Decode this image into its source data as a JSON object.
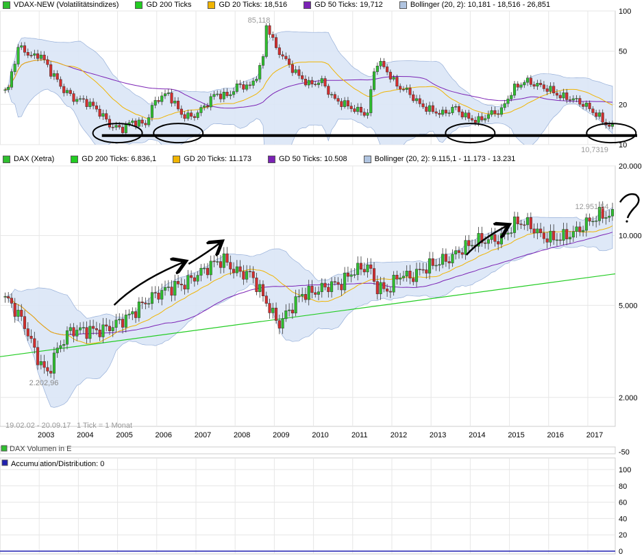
{
  "colors": {
    "candle_up": "#2fbf2f",
    "candle_down": "#d42e2e",
    "gd200": "#22cc22",
    "gd20": "#f0b400",
    "gd50": "#7b22b5",
    "bollinger_fill": "#dbe6f7",
    "bollinger_line": "#8aa6d4",
    "grid": "#e6e6e6",
    "annotation": "#000000",
    "acc_line": "#1f1fb0"
  },
  "panels": {
    "vdax": {
      "legend": [
        {
          "label": "VDAX-NEW (Volatilitätsindizes)",
          "color": "#2fbf2f"
        },
        {
          "label": "GD 200 Ticks",
          "color": "#22cc22"
        },
        {
          "label": "GD 20 Ticks: 18,516",
          "color": "#f0b400"
        },
        {
          "label": "GD 50 Ticks: 19,712",
          "color": "#7b22b5"
        },
        {
          "label": "Bollinger (20, 2): 10,181 - 18,516 - 26,851",
          "color": "#b0c4e0"
        }
      ],
      "high_label": "85,118",
      "low_label": "10,7319"
    },
    "dax": {
      "legend": [
        {
          "label": "DAX (Xetra)",
          "color": "#2fbf2f"
        },
        {
          "label": "GD 200 Ticks: 6.836,1",
          "color": "#22cc22"
        },
        {
          "label": "GD 20 Ticks: 11.173",
          "color": "#f0b400"
        },
        {
          "label": "GD 50 Ticks: 10.508",
          "color": "#7b22b5"
        },
        {
          "label": "Bollinger (20, 2): 9.115,1 - 11.173 - 13.231",
          "color": "#b0c4e0"
        }
      ],
      "high_label": "12.951,54",
      "low_label": "2.202,96",
      "date_range": "19.02.02 - 20.09.17",
      "tick_info": "1 Tick = 1 Monat"
    },
    "volume": {
      "legend_label": "DAX Volumen in E",
      "axis_label": "-50"
    },
    "acc": {
      "legend_label": "Accumulation/Distribution: 0",
      "color": "#1f1fb0"
    }
  },
  "chart_data": [
    {
      "type": "line",
      "title": "VDAX-NEW (Volatilitätsindizes)",
      "y_scale": "log",
      "ylim": [
        10,
        100
      ],
      "y_ticks": [
        "100",
        "50",
        "20",
        "10"
      ],
      "x": [
        2002.2,
        2002.5,
        2002.8,
        2003.0,
        2003.3,
        2003.6,
        2003.9,
        2004.2,
        2004.5,
        2004.8,
        2005.1,
        2005.4,
        2005.7,
        2006.0,
        2006.3,
        2006.6,
        2006.9,
        2007.2,
        2007.5,
        2007.8,
        2008.1,
        2008.4,
        2008.7,
        2008.8,
        2009.0,
        2009.3,
        2009.6,
        2009.9,
        2010.2,
        2010.5,
        2010.8,
        2011.1,
        2011.4,
        2011.6,
        2011.8,
        2012.1,
        2012.4,
        2012.7,
        2013.0,
        2013.3,
        2013.6,
        2013.9,
        2014.2,
        2014.5,
        2014.8,
        2015.1,
        2015.4,
        2015.7,
        2016.0,
        2016.3,
        2016.6,
        2016.9,
        2017.2,
        2017.5,
        2017.7
      ],
      "values": [
        25,
        55,
        45,
        48,
        35,
        26,
        22,
        21,
        18,
        14,
        13,
        15,
        14,
        22,
        24,
        17,
        16,
        19,
        24,
        23,
        28,
        27,
        40,
        80,
        55,
        42,
        33,
        28,
        30,
        22,
        20,
        18,
        17,
        42,
        38,
        28,
        25,
        20,
        18,
        17,
        19,
        16,
        15,
        17,
        18,
        26,
        30,
        28,
        26,
        23,
        22,
        20,
        17,
        14,
        13
      ],
      "annotations": [
        {
          "type": "horizontal_line",
          "y": 11.7
        },
        {
          "type": "ellipse",
          "x": 2005.0
        },
        {
          "type": "ellipse",
          "x": 2006.55
        },
        {
          "type": "ellipse",
          "x": 2014.0
        },
        {
          "type": "ellipse",
          "x": 2017.6
        }
      ]
    },
    {
      "type": "line",
      "title": "DAX (Xetra)",
      "y_scale": "log",
      "ylim": [
        1500,
        20000
      ],
      "y_ticks": [
        "20.000",
        "10.000",
        "5.000",
        "2.000"
      ],
      "x_ticks": [
        "2003",
        "2004",
        "2005",
        "2006",
        "2007",
        "2008",
        "2009",
        "2010",
        "2011",
        "2012",
        "2013",
        "2014",
        "2015",
        "2016",
        "2017"
      ],
      "x": [
        2002.2,
        2002.6,
        2002.9,
        2003.2,
        2003.5,
        2003.8,
        2004.2,
        2004.6,
        2004.9,
        2005.3,
        2005.6,
        2006.0,
        2006.4,
        2006.7,
        2007.0,
        2007.4,
        2007.7,
        2008.0,
        2008.4,
        2008.7,
        2008.9,
        2009.1,
        2009.4,
        2009.7,
        2010.0,
        2010.4,
        2010.7,
        2011.0,
        2011.4,
        2011.6,
        2011.9,
        2012.2,
        2012.5,
        2012.8,
        2013.2,
        2013.5,
        2013.8,
        2014.2,
        2014.5,
        2014.8,
        2015.2,
        2015.5,
        2015.8,
        2016.1,
        2016.4,
        2016.7,
        2017.0,
        2017.3,
        2017.6,
        2017.7
      ],
      "values": [
        5300,
        4200,
        3100,
        2500,
        3300,
        3900,
        3900,
        3900,
        4100,
        4500,
        5000,
        5600,
        6000,
        6200,
        6700,
        7500,
        7900,
        7000,
        6800,
        5500,
        4800,
        4100,
        4800,
        5600,
        5700,
        6100,
        6200,
        7000,
        7400,
        6000,
        5800,
        6800,
        6600,
        7200,
        7700,
        8000,
        8800,
        9500,
        9600,
        9700,
        11500,
        11200,
        10000,
        9700,
        9900,
        10400,
        11400,
        12300,
        12200,
        12300
      ],
      "gd200": {
        "x": [
          2002.0,
          2017.7
        ],
        "values": [
          3000,
          6836.1
        ]
      },
      "annotations": [
        {
          "type": "arrow",
          "direction": "up",
          "x": 2005.0
        },
        {
          "type": "arrow",
          "direction": "up",
          "x": 2007.6
        },
        {
          "type": "arrow",
          "direction": "up",
          "x": 2014.6
        },
        {
          "type": "question_mark",
          "x": 2018.0
        }
      ]
    },
    {
      "type": "line",
      "title": "Accumulation/Distribution: 0",
      "ylim": [
        0,
        100
      ],
      "y_ticks": [
        "100",
        "80",
        "60",
        "40",
        "20",
        "0"
      ],
      "values": [
        0,
        0
      ]
    }
  ]
}
